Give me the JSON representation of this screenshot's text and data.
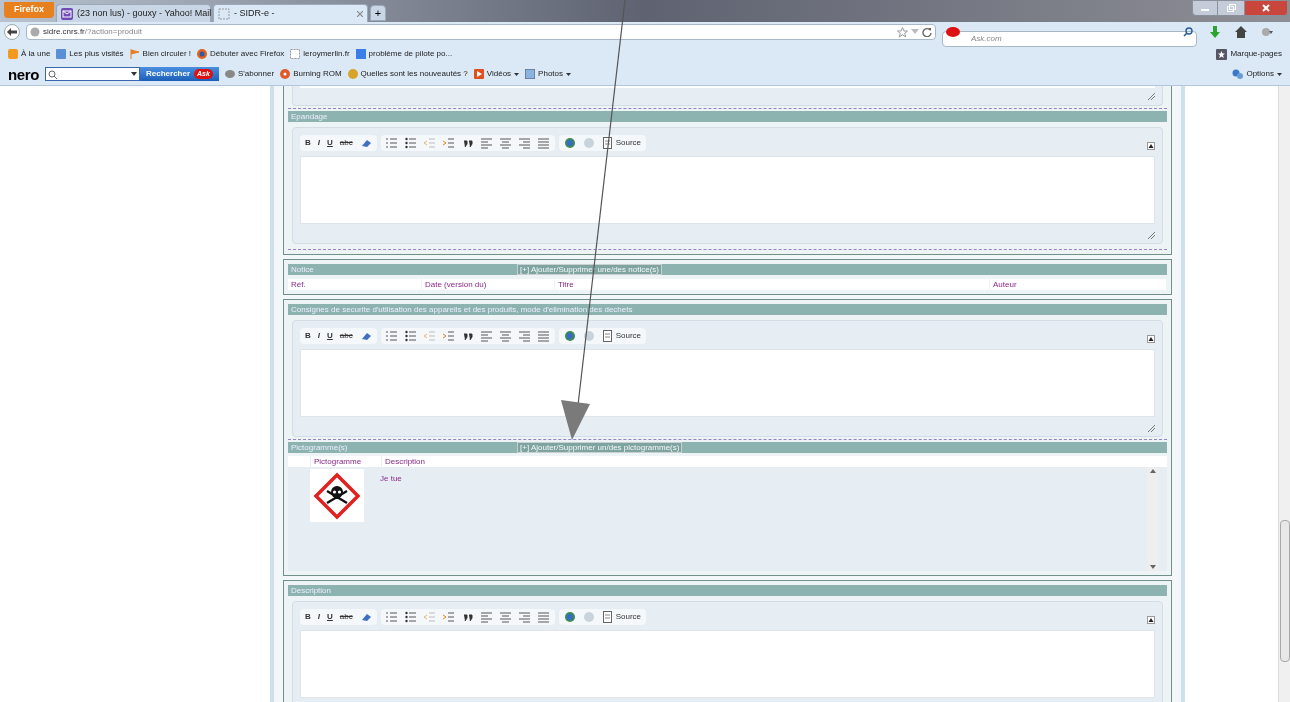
{
  "browser": {
    "menu_button": "Firefox",
    "tabs": [
      {
        "title": "(23 non lus) - gouxy - Yahoo! Mail",
        "kind": "mail",
        "selected": false
      },
      {
        "title": "- SIDR-e -",
        "kind": "page",
        "selected": true
      }
    ],
    "new_tab": "+",
    "url": {
      "host": "sidre.cnrs.fr",
      "path": "/?action=produit"
    },
    "search_placeholder": "Ask.com",
    "bookmarks": [
      {
        "label": "À la une",
        "kind": "rss"
      },
      {
        "label": "Les plus visités",
        "kind": "folder"
      },
      {
        "label": "Bien circuler !",
        "kind": "flag"
      },
      {
        "label": "Débuter avec Firefox",
        "kind": "firefox"
      },
      {
        "label": "leroymerlin.fr",
        "kind": "page"
      },
      {
        "label": "problème de pilote po...",
        "kind": "google"
      }
    ],
    "bookmarks_menu": "Marque-pages",
    "nero": {
      "logo": "nero",
      "search_button": "Rechercher",
      "badge": "Ask",
      "items": [
        {
          "label": "S'abonner",
          "kind": "rss",
          "dropdown": false
        },
        {
          "label": "Burning ROM",
          "kind": "disc",
          "dropdown": false
        },
        {
          "label": "Quelles sont les nouveautés ?",
          "kind": "news",
          "dropdown": false
        },
        {
          "label": "Vidéos",
          "kind": "video",
          "dropdown": true
        },
        {
          "label": "Photos",
          "kind": "photo",
          "dropdown": true
        }
      ],
      "options": "Options"
    }
  },
  "form": {
    "blocks": [
      {
        "parts": [
          {
            "kind": "editor_tail"
          },
          {
            "kind": "editor",
            "title": "Epandage",
            "toolbar": [
              "B",
              "I",
              "U",
              "abc"
            ],
            "source": "Source"
          }
        ]
      },
      {
        "parts": [
          {
            "kind": "list",
            "title": "Notice",
            "add_label": "[+] Ajouter/Supprimer une/des notice(s)",
            "columns": [
              "Réf.",
              "Date (version du)",
              "Titre",
              "Auteur"
            ]
          }
        ]
      },
      {
        "parts": [
          {
            "kind": "editor",
            "title": "Consignes de securite d'utilisation des appareils et des produits, mode d'elimination des dechets",
            "toolbar": [
              "B",
              "I",
              "U",
              "abc"
            ],
            "source": "Source"
          },
          {
            "kind": "pictos",
            "title": "Pictogramme(s)",
            "add_label": "[+] Ajouter/Supprimer un/des pictogramme(s)",
            "columns": [
              "Pictogramme",
              "Description"
            ],
            "rows": [
              {
                "description": "Je tue"
              }
            ]
          }
        ]
      },
      {
        "parts": [
          {
            "kind": "editor",
            "title": "Description",
            "toolbar": [
              "B",
              "I",
              "U",
              "abc"
            ],
            "source": "Source"
          }
        ]
      }
    ]
  }
}
